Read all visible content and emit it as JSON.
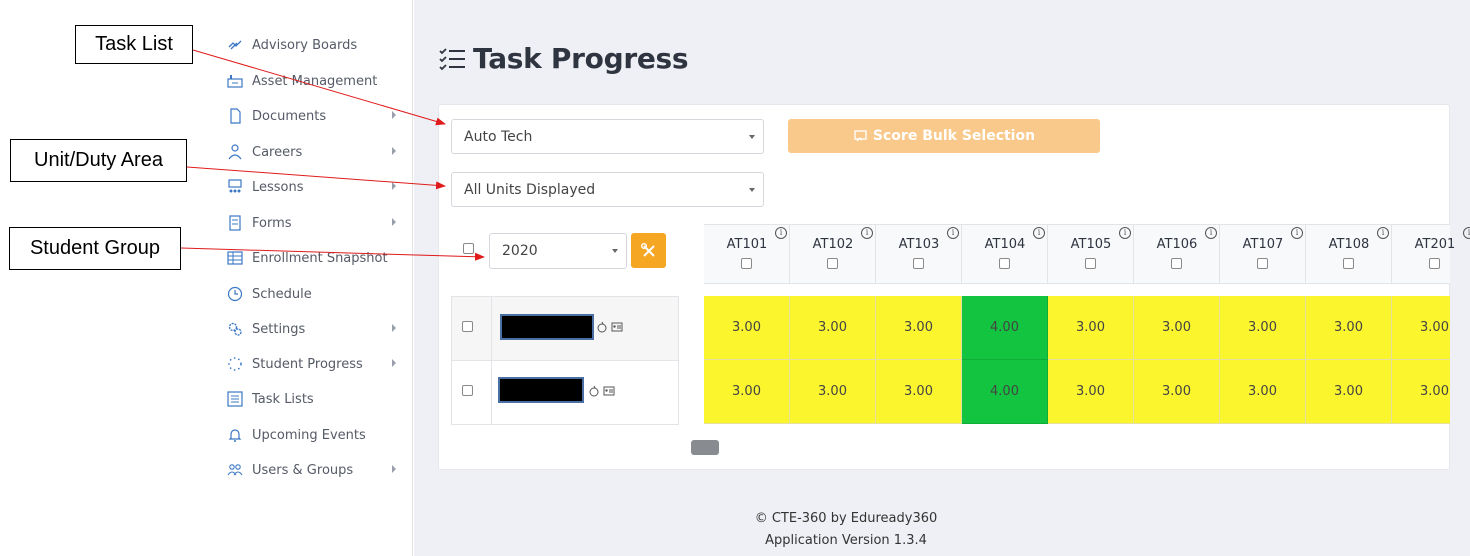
{
  "sidebar": {
    "items": [
      {
        "label": "Advisory Boards",
        "icon": "handshake-icon",
        "submenu": false
      },
      {
        "label": "Asset Management",
        "icon": "factory-icon",
        "submenu": false
      },
      {
        "label": "Documents",
        "icon": "document-icon",
        "submenu": true
      },
      {
        "label": "Careers",
        "icon": "person-tie-icon",
        "submenu": true
      },
      {
        "label": "Lessons",
        "icon": "classroom-icon",
        "submenu": true
      },
      {
        "label": "Forms",
        "icon": "form-icon",
        "submenu": true
      },
      {
        "label": "Enrollment Snapshot",
        "icon": "table-icon",
        "submenu": false
      },
      {
        "label": "Schedule",
        "icon": "clock-icon",
        "submenu": false
      },
      {
        "label": "Settings",
        "icon": "gears-icon",
        "submenu": true
      },
      {
        "label": "Student Progress",
        "icon": "spinner-icon",
        "submenu": true
      },
      {
        "label": "Task Lists",
        "icon": "list-icon",
        "submenu": false
      },
      {
        "label": "Upcoming Events",
        "icon": "bell-icon",
        "submenu": false
      },
      {
        "label": "Users & Groups",
        "icon": "users-icon",
        "submenu": true
      }
    ]
  },
  "page": {
    "title": "Task Progress",
    "title_icon": "checklist-icon"
  },
  "filters": {
    "task_list": "Auto Tech",
    "unit_duty_area": "All Units Displayed",
    "student_group": "2020"
  },
  "toolbar": {
    "bulk_label": "Score Bulk Selection",
    "bulk_icon": "score-icon",
    "tool_icon": "tools-icon"
  },
  "columns": [
    "AT101",
    "AT102",
    "AT103",
    "AT104",
    "AT105",
    "AT106",
    "AT107",
    "AT108",
    "AT201"
  ],
  "info_glyph": "i",
  "rows": [
    {
      "scores": [
        "3.00",
        "3.00",
        "3.00",
        "4.00",
        "3.00",
        "3.00",
        "3.00",
        "3.00",
        "3.00"
      ]
    },
    {
      "scores": [
        "3.00",
        "3.00",
        "3.00",
        "4.00",
        "3.00",
        "3.00",
        "3.00",
        "3.00",
        "3.00"
      ]
    }
  ],
  "colors": {
    "score_3": "#fbf52e",
    "score_4": "#12c43f",
    "accent": "#f5a623",
    "bulk_disabled": "#f9c98b"
  },
  "footer": {
    "copyright": "© CTE-360 by Eduready360",
    "version": "Application Version 1.3.4"
  },
  "annotations": {
    "task_list": "Task List",
    "unit_duty_area": "Unit/Duty Area",
    "student_group": "Student Group"
  }
}
